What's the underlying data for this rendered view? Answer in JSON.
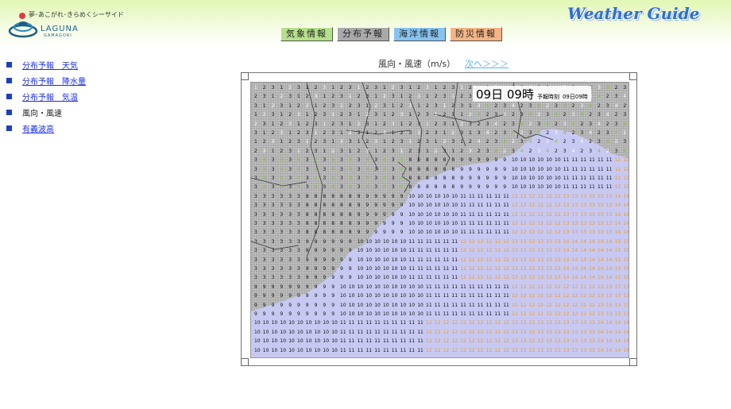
{
  "header": {
    "tagline": "夢･あこがれ･きらめくシーサイド",
    "logo_text": "LAGUNA",
    "logo_sub": "GAMAGORI",
    "brand": "Weather Guide"
  },
  "nav": [
    {
      "label": "気象情報",
      "color": "#b5e08a"
    },
    {
      "label": "分布予報",
      "color": "#a9a9a9"
    },
    {
      "label": "海洋情報",
      "color": "#86c3f0"
    },
    {
      "label": "防災情報",
      "color": "#f4b483"
    }
  ],
  "sidebar": [
    {
      "label": "分布予報　天気",
      "link": true
    },
    {
      "label": "分布予報　降水量",
      "link": true
    },
    {
      "label": "分布予報　気温",
      "link": true
    },
    {
      "label": "風向・風速",
      "link": false
    },
    {
      "label": "有義波高",
      "link": true
    }
  ],
  "map": {
    "title": "風向・風速（m/s）",
    "next_label": "次へ＞＞＞",
    "time": "09日 09時",
    "forecast_label": "予報時刻",
    "forecast_time": "09日09時",
    "colors": {
      "low": "#111111",
      "mid": "#7ec23a",
      "high": "#ec9a2d",
      "max": "#ffffff"
    }
  }
}
